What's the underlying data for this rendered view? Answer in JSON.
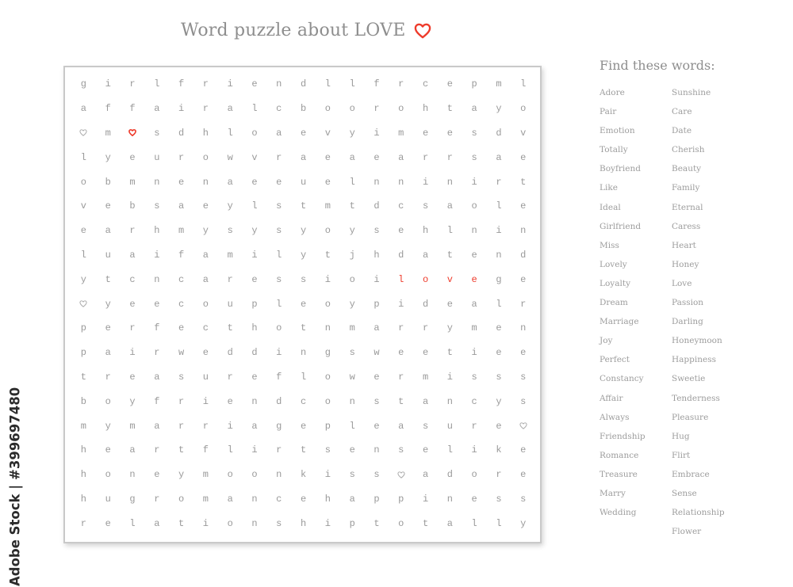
{
  "title": {
    "text": "Word puzzle about LOVE",
    "icon": "heart-outline-icon"
  },
  "colors": {
    "accent": "#ee3b2b",
    "letters": "#9a9a9a",
    "text": "#8e8e8e"
  },
  "grid": {
    "rows": [
      [
        "g",
        "i",
        "r",
        "l",
        "f",
        "r",
        "i",
        "e",
        "n",
        "d",
        "l",
        "l",
        "f",
        "r",
        "c",
        "e",
        "p",
        "m",
        "l"
      ],
      [
        "a",
        "f",
        "f",
        "a",
        "i",
        "r",
        "a",
        "l",
        "c",
        "b",
        "o",
        "o",
        "r",
        "o",
        "h",
        "t",
        "a",
        "y",
        "o"
      ],
      [
        "♡",
        "m",
        "♥",
        "s",
        "d",
        "h",
        "l",
        "o",
        "a",
        "e",
        "v",
        "y",
        "i",
        "m",
        "e",
        "e",
        "s",
        "d",
        "v"
      ],
      [
        "l",
        "y",
        "e",
        "u",
        "r",
        "o",
        "w",
        "v",
        "r",
        "a",
        "e",
        "a",
        "e",
        "a",
        "r",
        "r",
        "s",
        "a",
        "e"
      ],
      [
        "o",
        "b",
        "m",
        "n",
        "e",
        "n",
        "a",
        "e",
        "e",
        "u",
        "e",
        "l",
        "n",
        "n",
        "i",
        "n",
        "i",
        "r",
        "t"
      ],
      [
        "v",
        "e",
        "b",
        "s",
        "a",
        "e",
        "y",
        "l",
        "s",
        "t",
        "m",
        "t",
        "d",
        "c",
        "s",
        "a",
        "o",
        "l",
        "e"
      ],
      [
        "e",
        "a",
        "r",
        "h",
        "m",
        "y",
        "s",
        "y",
        "s",
        "y",
        "o",
        "y",
        "s",
        "e",
        "h",
        "l",
        "n",
        "i",
        "n"
      ],
      [
        "l",
        "u",
        "a",
        "i",
        "f",
        "a",
        "m",
        "i",
        "l",
        "y",
        "t",
        "j",
        "h",
        "d",
        "a",
        "t",
        "e",
        "n",
        "d"
      ],
      [
        "y",
        "t",
        "c",
        "n",
        "c",
        "a",
        "r",
        "e",
        "s",
        "s",
        "i",
        "o",
        "i",
        "l",
        "o",
        "v",
        "e",
        "g",
        "e"
      ],
      [
        "♡",
        "y",
        "e",
        "e",
        "c",
        "o",
        "u",
        "p",
        "l",
        "e",
        "o",
        "y",
        "p",
        "i",
        "d",
        "e",
        "a",
        "l",
        "r"
      ],
      [
        "p",
        "e",
        "r",
        "f",
        "e",
        "c",
        "t",
        "h",
        "o",
        "t",
        "n",
        "m",
        "a",
        "r",
        "r",
        "y",
        "m",
        "e",
        "n"
      ],
      [
        "p",
        "a",
        "i",
        "r",
        "w",
        "e",
        "d",
        "d",
        "i",
        "n",
        "g",
        "s",
        "w",
        "e",
        "e",
        "t",
        "i",
        "e",
        "e"
      ],
      [
        "t",
        "r",
        "e",
        "a",
        "s",
        "u",
        "r",
        "e",
        "f",
        "l",
        "o",
        "w",
        "e",
        "r",
        "m",
        "i",
        "s",
        "s",
        "s"
      ],
      [
        "b",
        "o",
        "y",
        "f",
        "r",
        "i",
        "e",
        "n",
        "d",
        "c",
        "o",
        "n",
        "s",
        "t",
        "a",
        "n",
        "c",
        "y",
        "s"
      ],
      [
        "m",
        "y",
        "m",
        "a",
        "r",
        "r",
        "i",
        "a",
        "g",
        "e",
        "p",
        "l",
        "e",
        "a",
        "s",
        "u",
        "r",
        "e",
        "♡"
      ],
      [
        "h",
        "e",
        "a",
        "r",
        "t",
        "f",
        "l",
        "i",
        "r",
        "t",
        "s",
        "e",
        "n",
        "s",
        "e",
        "l",
        "i",
        "k",
        "e"
      ],
      [
        "h",
        "o",
        "n",
        "e",
        "y",
        "m",
        "o",
        "o",
        "n",
        "k",
        "i",
        "s",
        "s",
        "♡",
        "a",
        "d",
        "o",
        "r",
        "e"
      ],
      [
        "h",
        "u",
        "g",
        "r",
        "o",
        "m",
        "a",
        "n",
        "c",
        "e",
        "h",
        "a",
        "p",
        "p",
        "i",
        "n",
        "e",
        "s",
        "s"
      ],
      [
        "r",
        "e",
        "l",
        "a",
        "t",
        "i",
        "o",
        "n",
        "s",
        "h",
        "i",
        "p",
        "t",
        "o",
        "t",
        "a",
        "l",
        "l",
        "y"
      ]
    ],
    "highlighted": [
      [
        2,
        2
      ],
      [
        8,
        13
      ],
      [
        8,
        14
      ],
      [
        8,
        15
      ],
      [
        8,
        16
      ]
    ],
    "found_words": [
      "love"
    ]
  },
  "word_list": {
    "heading": "Find these words:",
    "column1": [
      "Adore",
      "Pair",
      "Emotion",
      "Totally",
      "Boyfriend",
      "Like",
      "Ideal",
      "Girlfriend",
      "Miss",
      "Lovely",
      "Loyalty",
      "Dream",
      "Marriage",
      "Joy",
      "Perfect",
      "Constancy",
      "Affair",
      "Always",
      "Friendship",
      "Romance",
      "Treasure",
      "Marry",
      "Wedding"
    ],
    "column2": [
      "Sunshine",
      "Care",
      "Date",
      "Cherish",
      "Beauty",
      "Family",
      "Eternal",
      "Caress",
      "Heart",
      "Honey",
      "Love",
      "Passion",
      "Darling",
      "Honeymoon",
      "Happiness",
      "Sweetie",
      "Tenderness",
      "Pleasure",
      "Hug",
      "Flirt",
      "Embrace",
      "Sense",
      "Relationship",
      "Flower"
    ]
  },
  "watermark": {
    "text": "Adobe Stock | #399697480"
  }
}
